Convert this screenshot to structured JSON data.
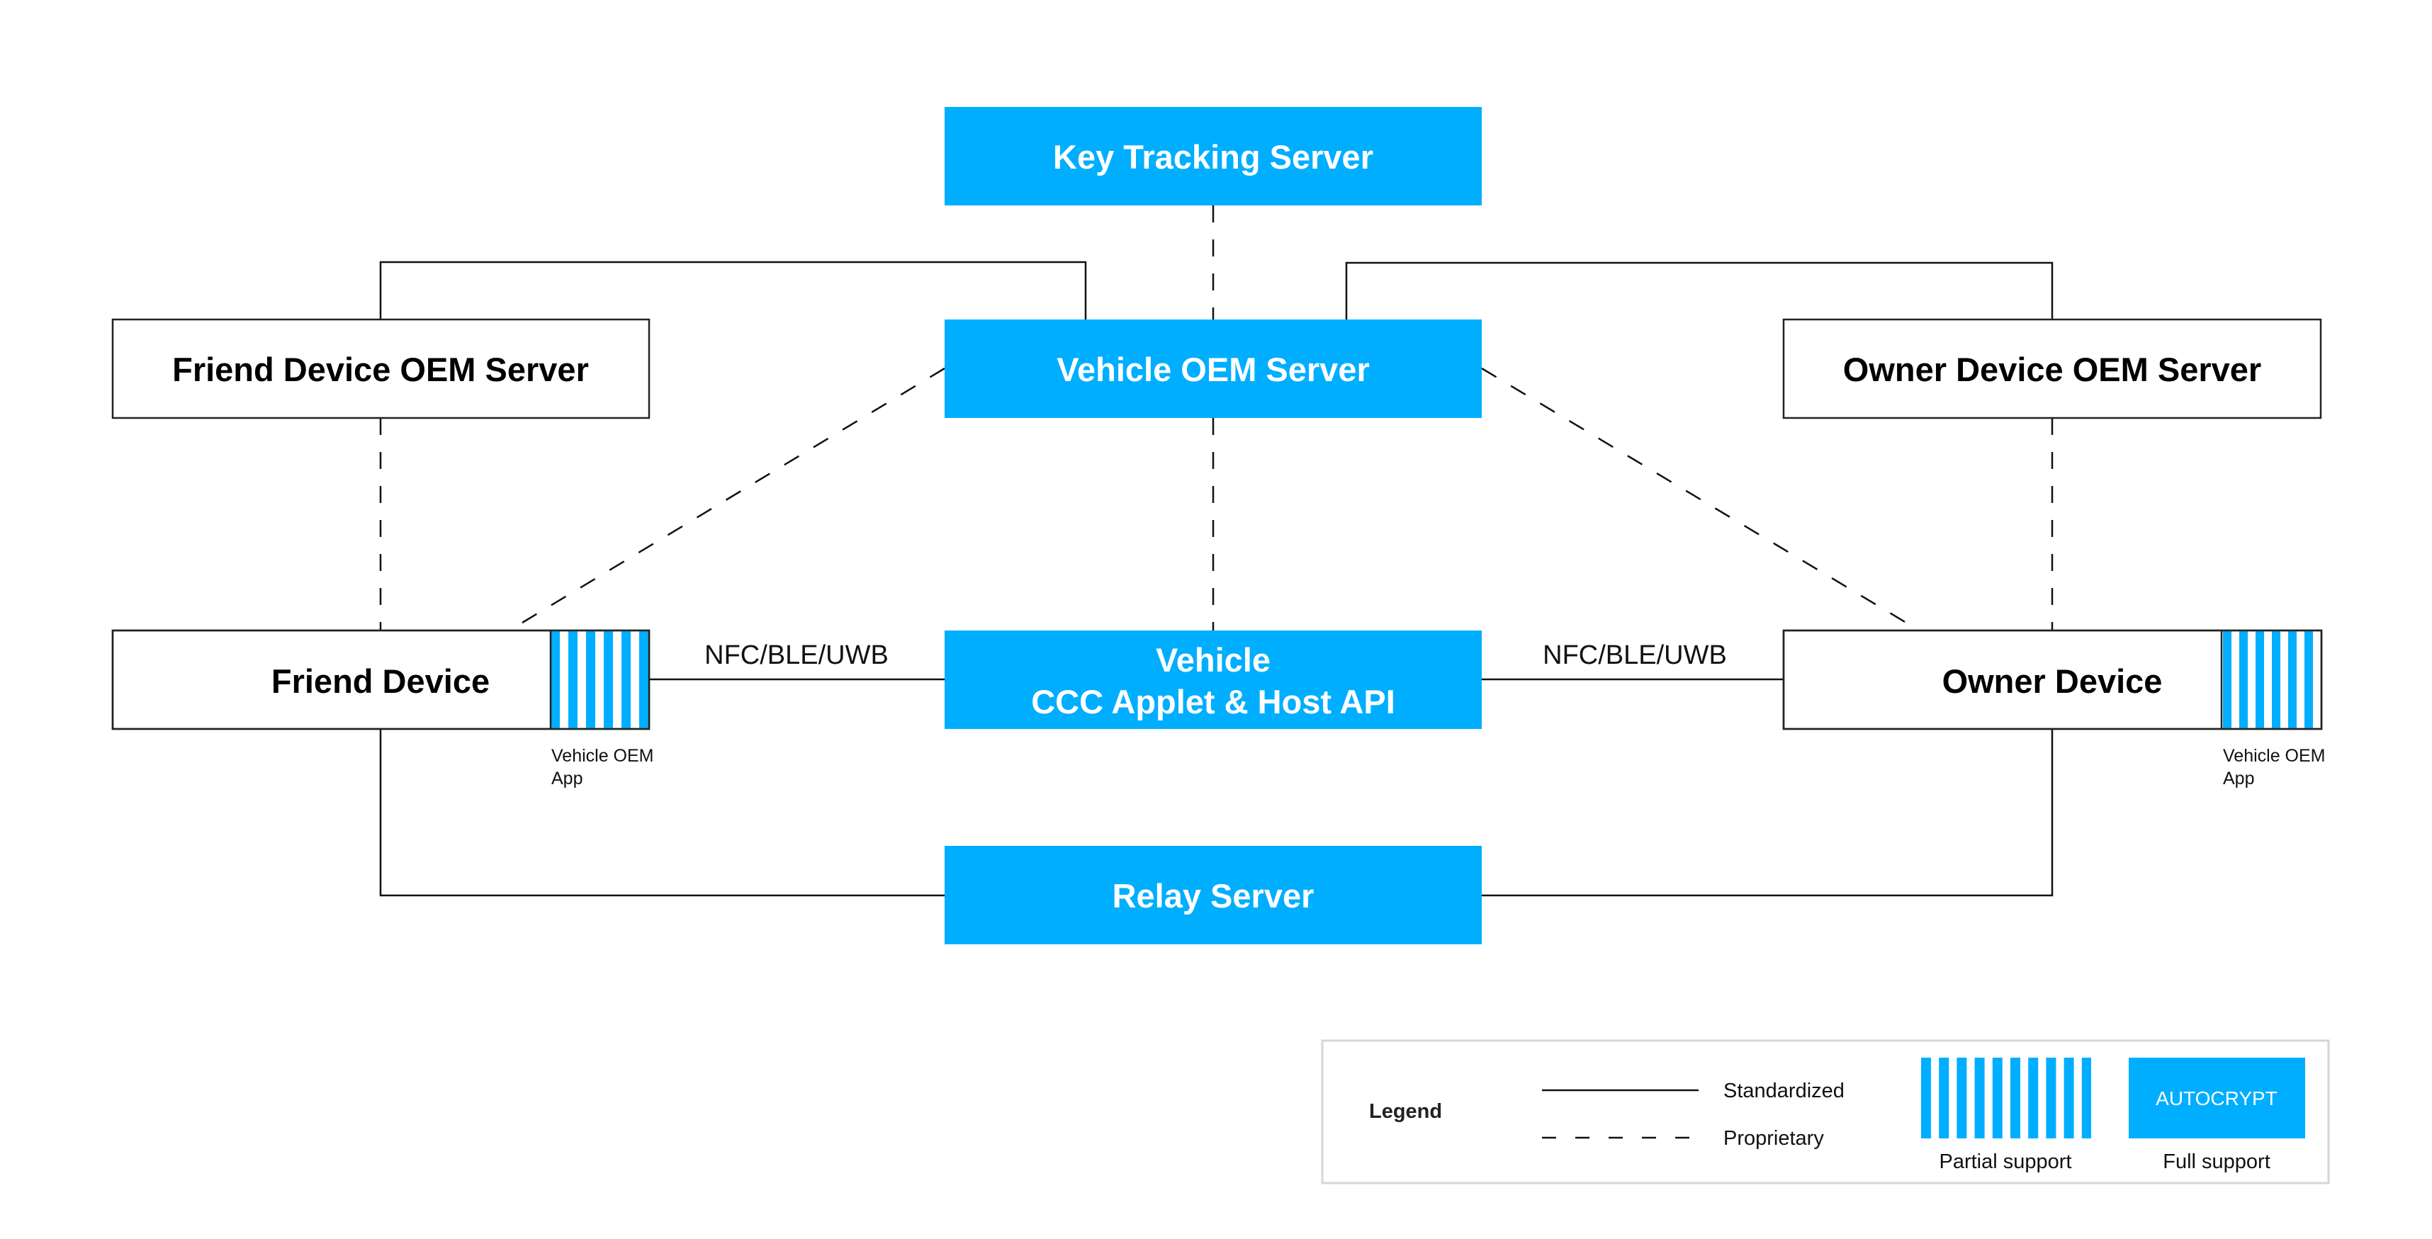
{
  "colors": {
    "full_support": "#00AEFF",
    "line": "#111111",
    "box_border": "#222222",
    "legend_border": "#D6D6D6"
  },
  "nodes": {
    "key_tracking_server": {
      "label": "Key Tracking Server",
      "support": "full"
    },
    "vehicle_oem_server": {
      "label": "Vehicle OEM Server",
      "support": "full"
    },
    "friend_device_oem_server": {
      "label": "Friend Device OEM Server",
      "support": "none"
    },
    "owner_device_oem_server": {
      "label": "Owner Device OEM Server",
      "support": "none"
    },
    "vehicle_ccc": {
      "label_line1": "Vehicle",
      "label_line2": "CCC Applet & Host API",
      "support": "full"
    },
    "friend_device": {
      "label": "Friend Device",
      "app_label_line1": "Vehicle OEM",
      "app_label_line2": "App",
      "app_support": "partial"
    },
    "owner_device": {
      "label": "Owner Device",
      "app_label_line1": "Vehicle OEM",
      "app_label_line2": "App",
      "app_support": "partial"
    },
    "relay_server": {
      "label": "Relay Server",
      "support": "full"
    }
  },
  "edges": [
    {
      "from": "key_tracking_server",
      "to": "vehicle_oem_server",
      "type": "proprietary"
    },
    {
      "from": "friend_device_oem_server",
      "to": "vehicle_oem_server",
      "type": "standardized"
    },
    {
      "from": "owner_device_oem_server",
      "to": "vehicle_oem_server",
      "type": "standardized"
    },
    {
      "from": "vehicle_oem_server",
      "to": "friend_device",
      "type": "proprietary"
    },
    {
      "from": "vehicle_oem_server",
      "to": "owner_device",
      "type": "proprietary"
    },
    {
      "from": "vehicle_oem_server",
      "to": "vehicle_ccc",
      "type": "proprietary"
    },
    {
      "from": "friend_device_oem_server",
      "to": "friend_device",
      "type": "proprietary"
    },
    {
      "from": "owner_device_oem_server",
      "to": "owner_device",
      "type": "proprietary"
    },
    {
      "from": "friend_device",
      "to": "vehicle_ccc",
      "type": "standardized",
      "label": "NFC/BLE/UWB"
    },
    {
      "from": "vehicle_ccc",
      "to": "owner_device",
      "type": "standardized",
      "label": "NFC/BLE/UWB"
    },
    {
      "from": "friend_device",
      "to": "relay_server",
      "type": "standardized"
    },
    {
      "from": "owner_device",
      "to": "relay_server",
      "type": "standardized"
    }
  ],
  "edge_labels": {
    "left_link": "NFC/BLE/UWB",
    "right_link": "NFC/BLE/UWB"
  },
  "legend": {
    "title": "Legend",
    "standardized": "Standardized",
    "proprietary": "Proprietary",
    "partial_support": "Partial support",
    "full_support": "Full support",
    "full_support_badge": "AUTOCRYPT"
  }
}
